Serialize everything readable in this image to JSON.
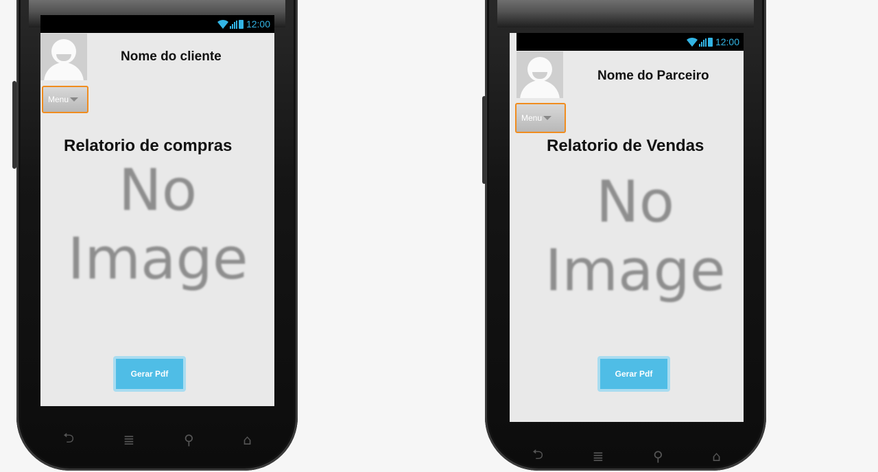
{
  "left": {
    "status_time": "12:00",
    "name": "Nome do cliente",
    "menu_label": "Menu",
    "report_title": "Relatorio de compras",
    "no_image_line1": "No",
    "no_image_line2": "Image",
    "pdf_button": "Gerar Pdf"
  },
  "right": {
    "status_time": "12:00",
    "name": "Nome do Parceiro",
    "menu_label": "Menu",
    "report_title": "Relatorio de Vendas",
    "no_image_line1": "No",
    "no_image_line2": "Image",
    "pdf_button": "Gerar Pdf"
  },
  "nav_icons": [
    "back-icon",
    "menu-lines-icon",
    "search-icon",
    "home-icon"
  ],
  "colors": {
    "accent_blue": "#33b5e5",
    "menu_border": "#f08c1e",
    "pdf_button": "#4fbde6"
  }
}
